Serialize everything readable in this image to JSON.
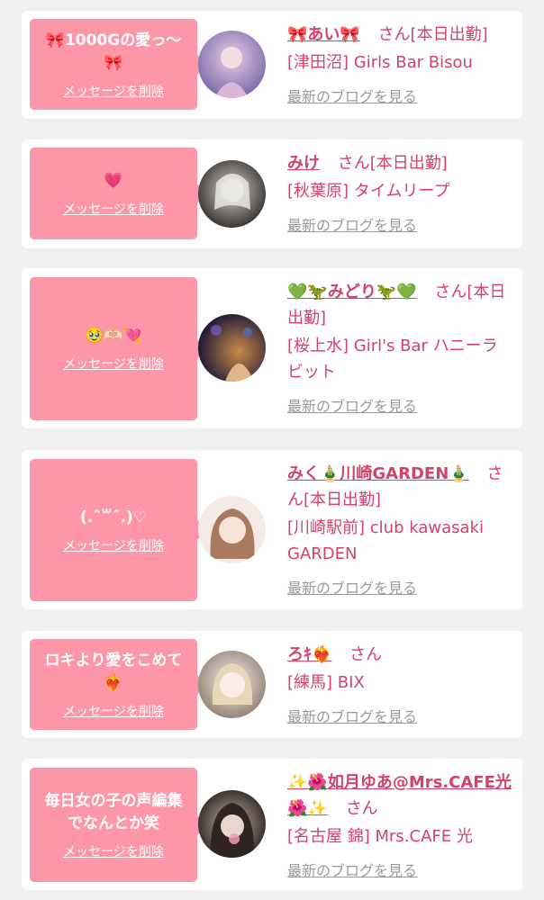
{
  "items": [
    {
      "message": "🎀1000Gの愛っ〜🎀",
      "delete_label": "メッセージを削除",
      "name": "🎀あい🎀",
      "san_status": "さん[本日出勤]",
      "shop": "[津田沼] Girls Bar Bisou",
      "blog_label": "最新のブログを見る",
      "avatar_colors": [
        "#b8a3d6",
        "#e5cfe8",
        "#7d6aa8"
      ]
    },
    {
      "message": "💗",
      "delete_label": "メッセージを削除",
      "name": "みけ",
      "san_status": "さん[本日出勤]",
      "shop": "[秋葉原] タイムリープ",
      "blog_label": "最新のブログを見る",
      "avatar_colors": [
        "#5a5450",
        "#d8d4cf",
        "#2b2724"
      ]
    },
    {
      "message": "🥹🫶🏻💘",
      "delete_label": "メッセージを削除",
      "name": "💚🦖みどり🦖💚",
      "san_status": "さん[本日出勤]",
      "shop": "[桜上水] Girl's Bar ハニーラビット",
      "blog_label": "最新のブログを見る",
      "avatar_colors": [
        "#3b3060",
        "#c98a4a",
        "#1e1838"
      ]
    },
    {
      "message": "(.ˆ꒳ˆ.)♡",
      "delete_label": "メッセージを削除",
      "name": "みく🎍川崎GARDEN🎍",
      "san_status": "さん[本日出勤]",
      "shop": "[川崎駅前] club kawasaki GARDEN",
      "blog_label": "最新のブログを見る",
      "avatar_colors": [
        "#c79c82",
        "#f3e4dc",
        "#6b4d3d"
      ]
    },
    {
      "message": "ロキより愛をこめて❤️‍🔥",
      "delete_label": "メッセージを削除",
      "name": "ろｷ❤️‍🔥",
      "san_status": "さん",
      "shop": "[練馬] BIX",
      "blog_label": "最新のブログを見る",
      "avatar_colors": [
        "#e6dcd3",
        "#f7f2ee",
        "#8d7b6c"
      ]
    },
    {
      "message": "毎日女の子の声編集でなんとか笑",
      "delete_label": "メッセージを削除",
      "name": "✨🌺如月ゆあ@Mrs.CAFE光🌺✨",
      "san_status": "さん",
      "shop": "[名古屋 錦] Mrs.CAFE 光",
      "blog_label": "最新のブログを見る",
      "avatar_colors": [
        "#4a3f3a",
        "#c9b4a8",
        "#1f1a18"
      ]
    }
  ]
}
